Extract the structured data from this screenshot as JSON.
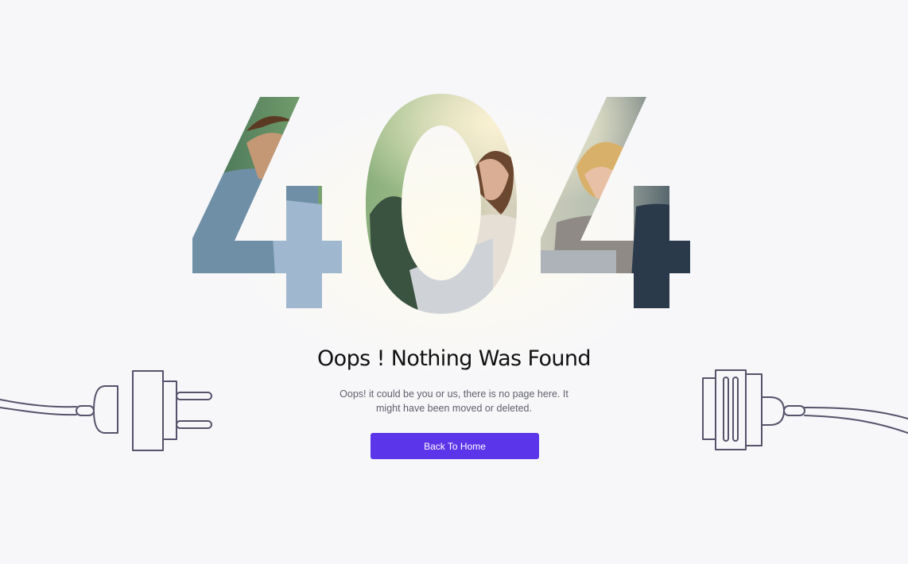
{
  "error_page": {
    "code": "404",
    "headline": "Oops ! Nothing Was Found",
    "message": "Oops! it could be you or us, there is no page here. It might have been moved or deleted.",
    "button_label": "Back To Home"
  },
  "theme": {
    "accent": "#5b35ea",
    "background": "#f7f7fa",
    "line_color": "#55536a"
  },
  "icons": {
    "left": "plug-icon",
    "right": "socket-icon"
  }
}
